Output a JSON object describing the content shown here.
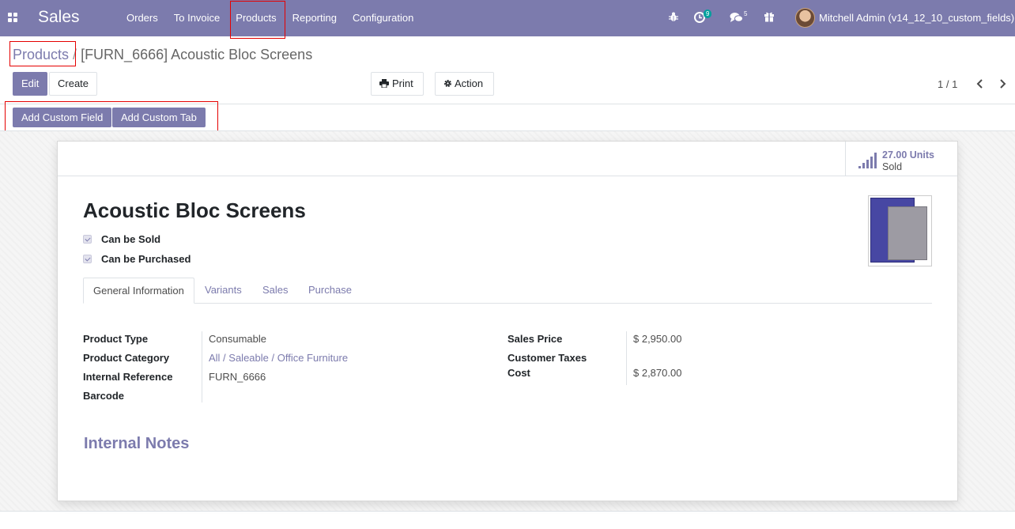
{
  "navbar": {
    "app_name": "Sales",
    "menu": [
      {
        "label": "Orders"
      },
      {
        "label": "To Invoice"
      },
      {
        "label": "Products"
      },
      {
        "label": "Reporting"
      },
      {
        "label": "Configuration"
      }
    ],
    "activity_count": "9",
    "message_count": "5",
    "user_name": "Mitchell Admin (v14_12_10_custom_fields)",
    "icons": [
      "apps-icon",
      "bug-icon",
      "clock-icon",
      "chat-icon",
      "gift-icon"
    ]
  },
  "breadcrumb": {
    "parent": "Products",
    "separator": "/",
    "current": "[FURN_6666] Acoustic Bloc Screens"
  },
  "toolbar": {
    "edit_label": "Edit",
    "create_label": "Create",
    "print_label": "Print",
    "action_label": "Action"
  },
  "pager": {
    "value": "1 / 1"
  },
  "custom": {
    "add_field_label": "Add Custom Field",
    "add_tab_label": "Add Custom Tab"
  },
  "stat": {
    "value": "27.00 Units",
    "label": "Sold"
  },
  "product": {
    "name": "Acoustic Bloc Screens",
    "can_be_sold_label": "Can be Sold",
    "can_be_purchased_label": "Can be Purchased"
  },
  "tabs": [
    {
      "label": "General Information",
      "active": true
    },
    {
      "label": "Variants"
    },
    {
      "label": "Sales"
    },
    {
      "label": "Purchase"
    }
  ],
  "left_fields": [
    {
      "label": "Product Type",
      "value": "Consumable"
    },
    {
      "label": "Product Category",
      "value": "All / Saleable / Office Furniture"
    },
    {
      "label": "Internal Reference",
      "value": "FURN_6666"
    },
    {
      "label": "Barcode",
      "value": ""
    }
  ],
  "right_fields": [
    {
      "label": "Sales Price",
      "value": "$ 2,950.00"
    },
    {
      "label": "Customer Taxes",
      "value": ""
    },
    {
      "label": "Cost",
      "value": "$ 2,870.00"
    }
  ],
  "notes_title": "Internal Notes",
  "colors": {
    "brand": "#7c7bad",
    "highlight": "#e50000",
    "badge": "#00a09d"
  }
}
